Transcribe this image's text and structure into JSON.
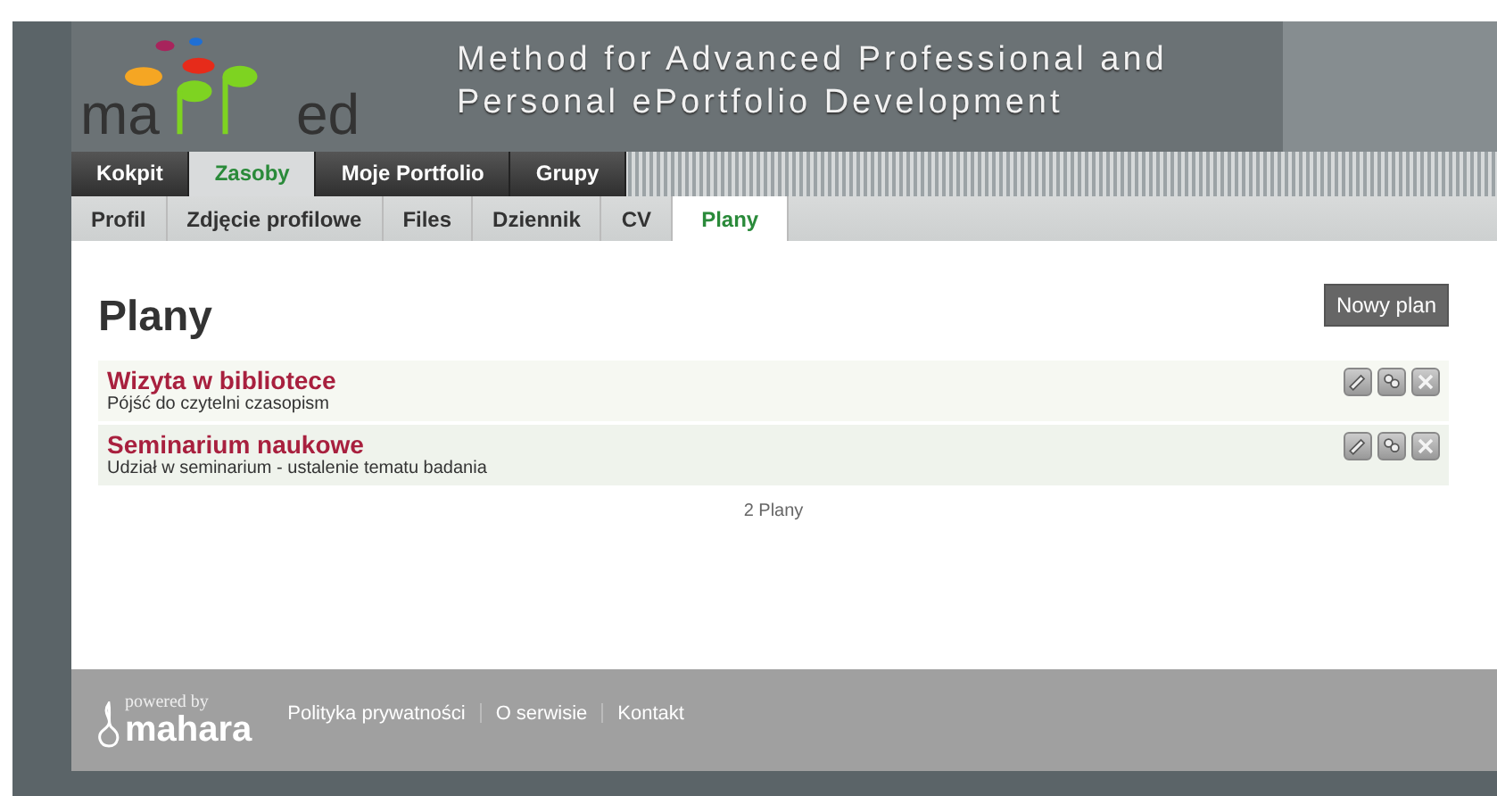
{
  "logo": {
    "left": "ma",
    "right": "ed"
  },
  "header": {
    "title_lines": [
      "Method for Advanced Professional and",
      "Personal ePortfolio Development"
    ]
  },
  "main_tabs": [
    {
      "label": "Kokpit",
      "selected": false
    },
    {
      "label": "Zasoby",
      "selected": true
    },
    {
      "label": "Moje Portfolio",
      "selected": false
    },
    {
      "label": "Grupy",
      "selected": false
    }
  ],
  "sub_tabs": [
    {
      "label": "Profil",
      "selected": false
    },
    {
      "label": "Zdjęcie profilowe",
      "selected": false
    },
    {
      "label": "Files",
      "selected": false
    },
    {
      "label": "Dziennik",
      "selected": false
    },
    {
      "label": "CV",
      "selected": false
    },
    {
      "label": "Plany",
      "selected": true
    }
  ],
  "page": {
    "heading": "Plany",
    "new_button": "Nowy plan"
  },
  "plans": [
    {
      "title": "Wizyta w bibliotece",
      "description": "Pójść do czytelni czasopism"
    },
    {
      "title": "Seminarium naukowe",
      "description": "Udział w seminarium - ustalenie tematu badania"
    }
  ],
  "count": "2 Plany",
  "footer": {
    "powered_by": "powered by",
    "brand": "mahara",
    "links": [
      "Polityka prywatności",
      "O serwisie",
      "Kontakt"
    ]
  }
}
